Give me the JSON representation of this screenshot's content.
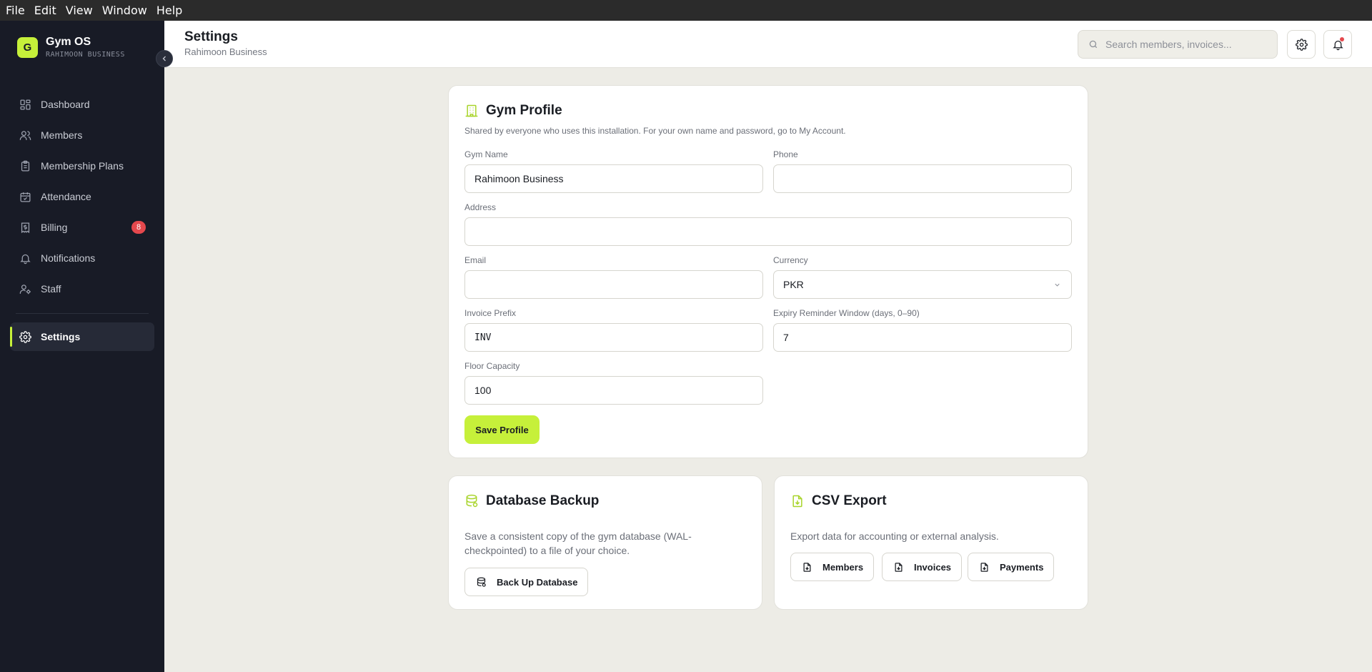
{
  "menubar": [
    "File",
    "Edit",
    "View",
    "Window",
    "Help"
  ],
  "brand": {
    "logo_letter": "G",
    "name": "Gym OS",
    "subtitle": "RAHIMOON BUSINESS"
  },
  "sidebar": {
    "items": [
      {
        "label": "Dashboard",
        "icon": "dashboard-icon"
      },
      {
        "label": "Members",
        "icon": "users-icon"
      },
      {
        "label": "Membership Plans",
        "icon": "clipboard-icon"
      },
      {
        "label": "Attendance",
        "icon": "calendar-check-icon"
      },
      {
        "label": "Billing",
        "icon": "receipt-icon",
        "badge": "8"
      },
      {
        "label": "Notifications",
        "icon": "bell-icon"
      },
      {
        "label": "Staff",
        "icon": "user-cog-icon"
      }
    ],
    "settings": {
      "label": "Settings",
      "icon": "gear-icon",
      "active": true
    }
  },
  "header": {
    "title": "Settings",
    "subtitle": "Rahimoon Business",
    "search_placeholder": "Search members, invoices..."
  },
  "gym_profile": {
    "title": "Gym Profile",
    "description": "Shared by everyone who uses this installation. For your own name and password, go to My Account.",
    "fields": {
      "gym_name": {
        "label": "Gym Name",
        "value": "Rahimoon Business"
      },
      "phone": {
        "label": "Phone",
        "value": ""
      },
      "address": {
        "label": "Address",
        "value": ""
      },
      "email": {
        "label": "Email",
        "value": ""
      },
      "currency": {
        "label": "Currency",
        "value": "PKR"
      },
      "invoice_prefix": {
        "label": "Invoice Prefix",
        "value": "INV"
      },
      "expiry_reminder": {
        "label": "Expiry Reminder Window (days, 0–90)",
        "value": "7"
      },
      "floor_capacity": {
        "label": "Floor Capacity",
        "value": "100"
      }
    },
    "save_label": "Save Profile"
  },
  "backup": {
    "title": "Database Backup",
    "description": "Save a consistent copy of the gym database (WAL-checkpointed) to a file of your choice.",
    "button_label": "Back Up Database"
  },
  "csv_export": {
    "title": "CSV Export",
    "description": "Export data for accounting or external analysis.",
    "buttons": [
      "Members",
      "Invoices",
      "Payments"
    ]
  },
  "colors": {
    "accent": "#c6f03a",
    "sidebar_bg": "#181b26",
    "badge": "#e5484d",
    "page_bg": "#edece6"
  }
}
